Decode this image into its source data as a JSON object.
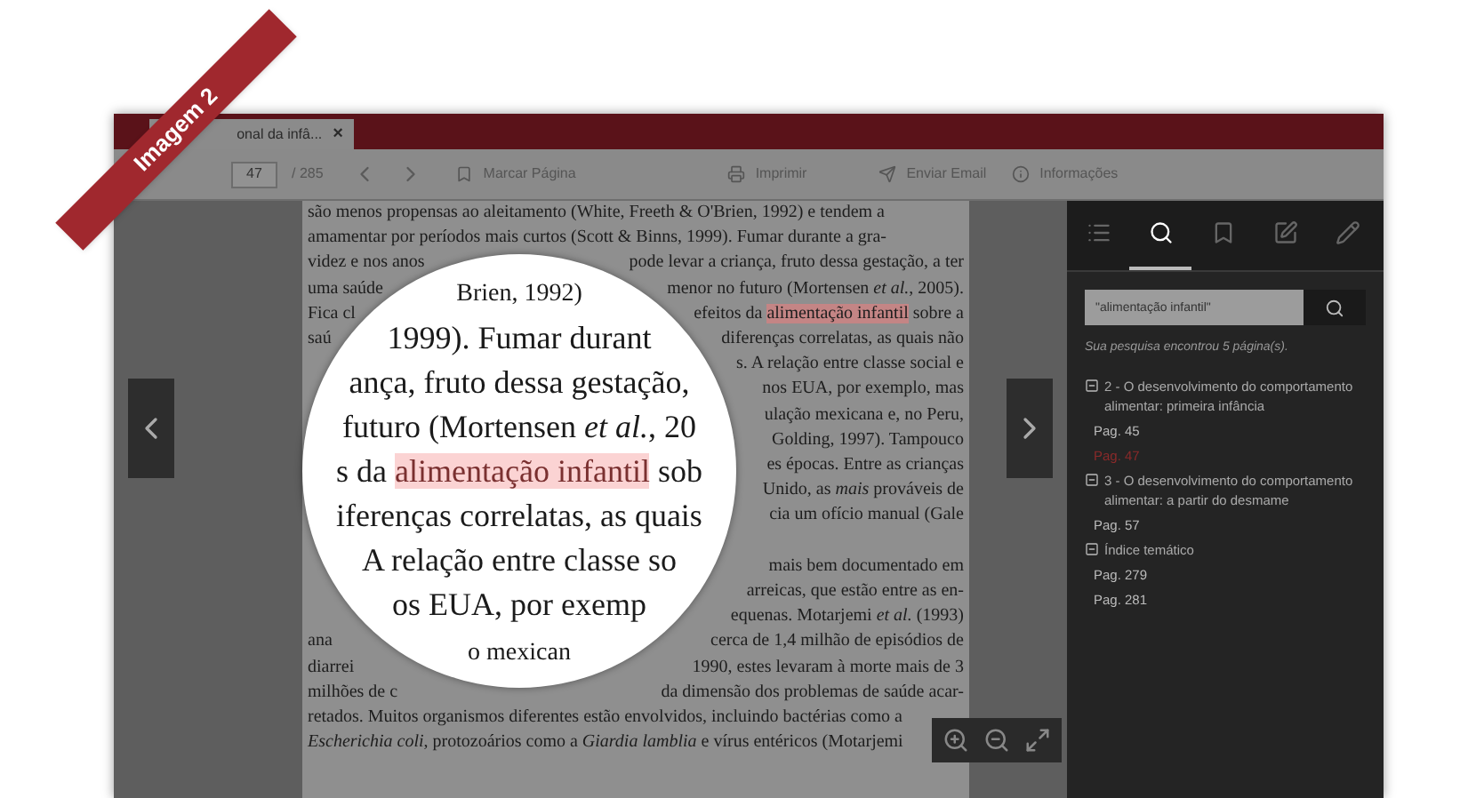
{
  "ribbon": "Imagem 2",
  "tab": {
    "title": "onal da infâ...",
    "close": "×"
  },
  "toolbar": {
    "page": "47",
    "total": "/ 285",
    "actions": [
      {
        "kind": "bookmark",
        "label": "Marcar Página"
      },
      {
        "kind": "print",
        "label": "Imprimir"
      },
      {
        "kind": "send",
        "label": "Enviar Email"
      },
      {
        "kind": "info",
        "label": "Informações"
      }
    ]
  },
  "page_lines": [
    {
      "left": "são menos propensas ao aleitamento (White, Freeth & O'Brien, 1992) e tendem a"
    },
    {
      "left": "amamentar por períodos mais curtos (Scott & Binns, 1999). Fumar durante a gra-"
    },
    {
      "left": "videz e nos anos",
      "right": "pode levar a criança, fruto dessa gestação, a ter"
    },
    {
      "left": "uma saúde",
      "right": "menor no futuro (Mortensen *et al.*, 2005)."
    },
    {
      "left": "Fica cl",
      "right": "efeitos da ",
      "highlight": "alimentação infantil",
      "after": " sobre a"
    },
    {
      "left": "saú",
      "right": "diferenças correlatas, as quais não"
    },
    {
      "right": "s. A relação entre classe social e"
    },
    {
      "right": "nos EUA, por exemplo, mas"
    },
    {
      "right": "ulação mexicana e, no Peru,"
    },
    {
      "right": "Golding, 1997). Tampouco"
    },
    {
      "right": "es épocas. Entre as crianças"
    },
    {
      "right": "Unido, as *mais* prováveis de"
    },
    {
      "right": "cia um ofício manual (Gale",
      "gap_after": true
    },
    {
      "right": "mais bem documentado em"
    },
    {
      "right": "arreicas, que estão entre as en-"
    },
    {
      "right": "equenas. Motarjemi *et al.* (1993)"
    },
    {
      "left": "ana",
      "right": "cerca de 1,4 milhão de episódios de"
    },
    {
      "left": "diarrei",
      "right": "1990, estes levaram à morte mais de 3"
    },
    {
      "left": "milhões de c",
      "right": "da dimensão dos problemas de saúde acar-"
    },
    {
      "left": "retados. Muitos organismos diferentes estão envolvidos, incluindo bactérias como a"
    },
    {
      "left": "*Escherichia coli*, protozoários como a *Giardia lamblia* e vírus entéricos (Motarjemi"
    }
  ],
  "magnifier": {
    "lines": [
      {
        "left": "Brien, 1992)"
      },
      {
        "left": "1999). Fumar durant"
      },
      {
        "left": "ança, fruto dessa gestação,"
      },
      {
        "left": "futuro (Mortensen *et al.*, 20"
      },
      {
        "left": "s da ",
        "highlight": "alimentação infantil",
        "after": " sob"
      },
      {
        "left": "iferenças correlatas, as quais"
      },
      {
        "left": "A relação entre classe so"
      },
      {
        "left": "os EUA, por exemp"
      },
      {
        "left": "o mexican"
      }
    ]
  },
  "sidebar": {
    "tabs": [
      {
        "kind": "list",
        "selected": false
      },
      {
        "kind": "search",
        "selected": true
      },
      {
        "kind": "bookmark",
        "selected": false
      },
      {
        "kind": "note",
        "selected": false
      },
      {
        "kind": "pencil",
        "selected": false
      }
    ],
    "search": {
      "value": "\"alimentação infantil\""
    },
    "summary": "Sua pesquisa encontrou 5 página(s).",
    "results": [
      {
        "title": "2 - O desenvolvimento do comportamento alimentar: primeira infância",
        "expanded": true,
        "children": [
          {
            "label": "Pag. 45",
            "selected": false
          },
          {
            "label": "Pag. 47",
            "selected": true
          }
        ]
      },
      {
        "title": "3 - O desenvolvimento do comportamento alimentar: a partir do desmame",
        "expanded": true,
        "children": [
          {
            "label": "Pag. 57",
            "selected": false
          }
        ]
      },
      {
        "title": "Índice temático",
        "expanded": true,
        "children": [
          {
            "label": "Pag. 279",
            "selected": false
          },
          {
            "label": "Pag. 281",
            "selected": false
          }
        ]
      }
    ]
  }
}
